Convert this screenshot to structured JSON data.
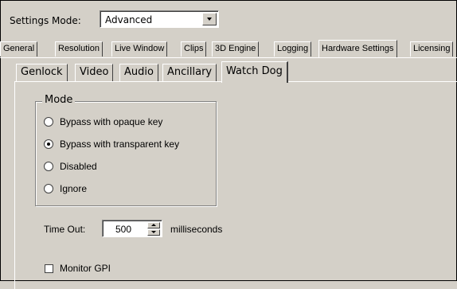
{
  "settings_mode": {
    "label": "Settings Mode:",
    "value": "Advanced"
  },
  "outer_tabs": [
    {
      "label": "General",
      "active": false
    },
    {
      "label": "Resolution",
      "active": false
    },
    {
      "label": "Live Window",
      "active": false
    },
    {
      "label": "Clips",
      "active": false
    },
    {
      "label": "3D Engine",
      "active": false
    },
    {
      "label": "Logging",
      "active": false
    },
    {
      "label": "Hardware Settings",
      "active": true
    },
    {
      "label": "Licensing",
      "active": false
    }
  ],
  "inner_tabs": [
    {
      "label": "Genlock",
      "active": false
    },
    {
      "label": "Video",
      "active": false
    },
    {
      "label": "Audio",
      "active": false
    },
    {
      "label": "Ancillary",
      "active": false
    },
    {
      "label": "Watch Dog",
      "active": true
    }
  ],
  "mode_group": {
    "title": "Mode",
    "options": [
      {
        "label": "Bypass with opaque key",
        "checked": false
      },
      {
        "label": "Bypass with transparent key",
        "checked": true
      },
      {
        "label": "Disabled",
        "checked": false
      },
      {
        "label": "Ignore",
        "checked": false
      }
    ]
  },
  "timeout": {
    "label": "Time Out:",
    "value": "500",
    "unit": "milliseconds"
  },
  "monitor_gpi": {
    "label": "Monitor GPI",
    "checked": false
  }
}
